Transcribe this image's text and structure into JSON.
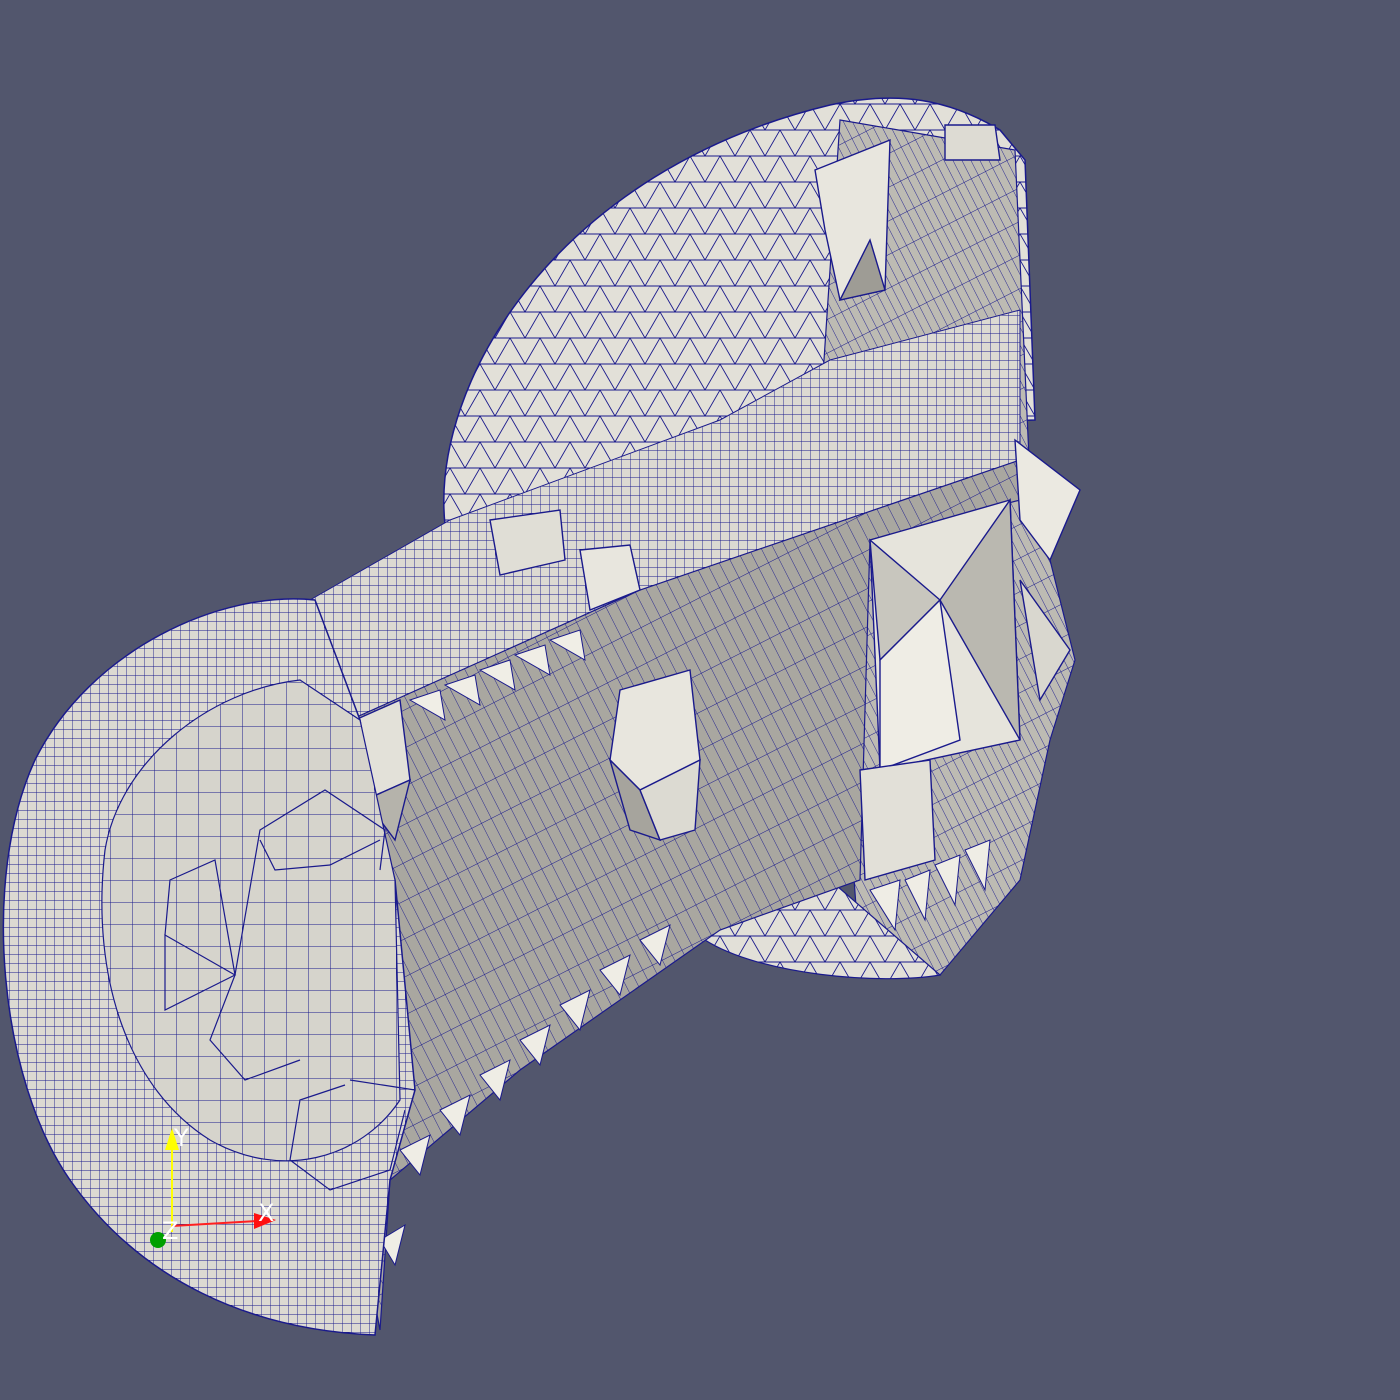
{
  "viewport": {
    "background": "#52566d",
    "mesh_fill": "#dcdad2",
    "mesh_edge_color": "#1a1a8c"
  },
  "orientation_axes": {
    "x_label": "X",
    "y_label": "Y",
    "z_label": "Z",
    "x_color": "#ff2020",
    "y_color": "#ffff00",
    "z_color": "#00a000",
    "label_color": "#ffffff"
  }
}
